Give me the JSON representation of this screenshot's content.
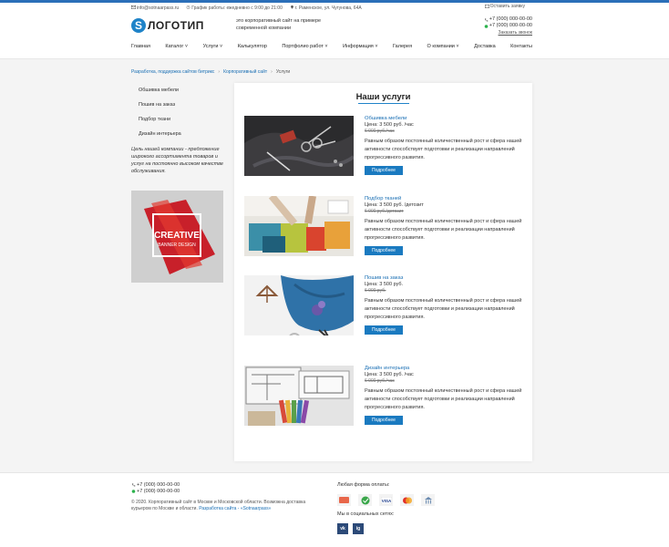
{
  "header": {
    "email": "info@sotnaarpass.ru",
    "schedule": "График работы: ежедневно с 9:00 до 21:00",
    "address": "г. Раменское, ул. Чугунова, 64А",
    "callback_link": "Оставить заявку",
    "logo_text": "ЛОГОТИП",
    "logo_letter": "S",
    "slogan": "это корпоративный сайт на примере современной компании",
    "phone1": "+7 (000) 000-00-00",
    "phone2": "+7 (000) 000-00-00",
    "call_order": "Заказать звонок"
  },
  "nav": {
    "items": [
      "Главная",
      "Каталог",
      "Услуги",
      "Калькулятор",
      "Портфолио работ",
      "Информация",
      "Галерея",
      "О компании",
      "Доставка",
      "Контакты"
    ]
  },
  "breadcrumbs": {
    "items": [
      "Разработка, поддержка сайтов битрикс",
      "Корпоративный сайт",
      "Услуги"
    ]
  },
  "sidebar": {
    "menu": [
      "Обшивка мебели",
      "Пошив на заказ",
      "Подбор ткани",
      "Дизайн интерьера"
    ],
    "mission": "Цель нашей компании - предложение широкого ассортимента товаров и услуг на постоянно высоком качестве обслуживания.",
    "banner_title": "CREATIVE",
    "banner_sub": "BANNER DESIGN"
  },
  "content": {
    "title": "Наши услуги",
    "services": [
      {
        "title": "Обшивка мебели",
        "price": "Цена: 3 500 руб. /час",
        "old_price": "6 000 руб./час",
        "desc": "Равным образом постоянный количественный рост и сфера нашей активности способствует подготовки и реализации направлений прогрессивного развития.",
        "button": "Подробнее",
        "image": "furniture-upholstery-photo"
      },
      {
        "title": "Подбор тканей",
        "price": "Цена: 3 500 руб. /детозит",
        "old_price": "6 000 руб./детозит",
        "desc": "Равным образом постоянный количественный рост и сфера нашей активности способствует подготовки и реализации направлений прогрессивного развития.",
        "button": "Подробнее",
        "image": "fabric-selection-photo"
      },
      {
        "title": "Пошив на заказ",
        "price": "Цена: 3 500 руб.",
        "old_price": "6 000 руб.",
        "desc": "Равным образом постоянный количественный рост и сфера нашей активности способствует подготовки и реализации направлений прогрессивного развития.",
        "button": "Подробнее",
        "image": "custom-tailoring-photo"
      },
      {
        "title": "Дизайн интерьера",
        "price": "Цена: 3 500 руб. /час",
        "old_price": "6 000 руб./час",
        "desc": "Равным образом постоянный количественный рост и сфера нашей активности способствует подготовки и реализации направлений прогрессивного развития.",
        "button": "Подробнее",
        "image": "interior-design-photo"
      }
    ]
  },
  "footer": {
    "phone1": "+7 (000) 000-00-00",
    "phone2": "+7 (000) 000-00-00",
    "copyright": "© 2020. Корпоративный сайт в Москве и Московской области. Возможна доставка курьером по Москве и области.",
    "dev_link": "Разработка сайта - «Sotnaarpass»",
    "payment_label": "Любая форма оплаты:",
    "payment_icons": [
      "cash-icon",
      "sber-icon",
      "visa-icon",
      "mastercard-icon",
      "bank-icon"
    ],
    "social_label": "Мы в социальных сетях:",
    "social_vk": "vk",
    "social_ig": "ig"
  },
  "colors": {
    "accent": "#1a7ac0",
    "topline": "#2b6fb8",
    "banner_red": "#c8202a"
  }
}
